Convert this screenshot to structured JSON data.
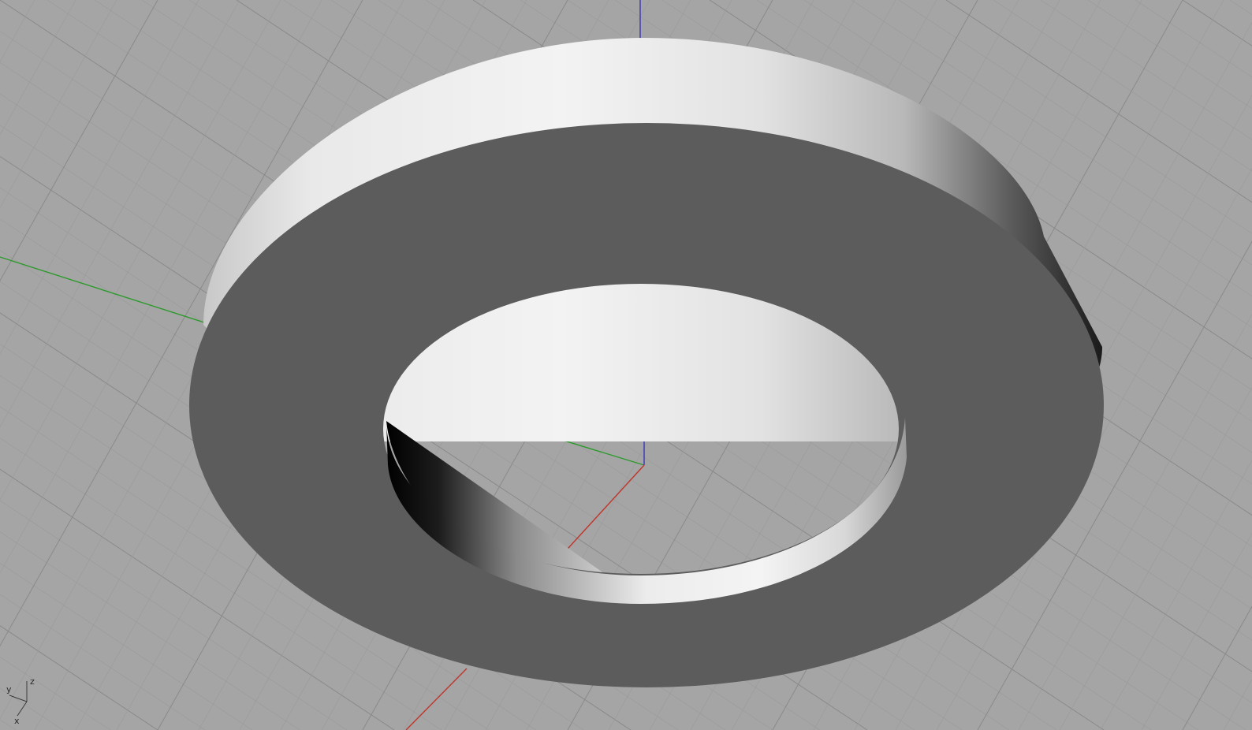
{
  "viewport": {
    "background_color": "#a5a5a5",
    "grid_minor_color": "#9a9a9a",
    "grid_major_color": "#8a8a8a",
    "axis_x_color": "#c0352b",
    "axis_y_color": "#2e9a2e",
    "axis_z_color": "#3838b8",
    "model": {
      "name": "washer",
      "top_face_color": "#5c5c5c",
      "side_highlight_color": "#f2f2f2",
      "side_shadow_color": "#000000"
    }
  },
  "gizmo": {
    "z_label": "z",
    "y_label": "y",
    "x_label": "x"
  }
}
